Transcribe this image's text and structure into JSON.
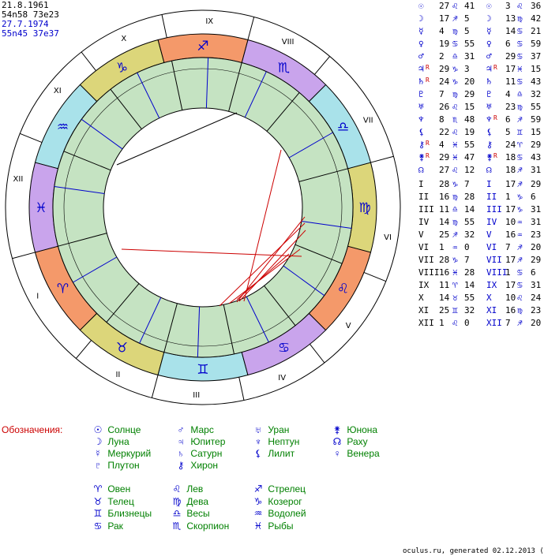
{
  "header": {
    "line1": "21.8.1961",
    "line2": "54n58 73e23",
    "line3": "27.7.1974",
    "line4": "55n45 37e37"
  },
  "colors": {
    "fire": "#f4996a",
    "earth": "#dcd67a",
    "air": "#a9e2ea",
    "water": "#c9a4ec",
    "house_ring": "#c5e3c2",
    "aspect_red": "#cc0000",
    "glyph_blue": "#0000cc",
    "text_green": "#008000"
  },
  "outer_houses": [
    "I",
    "II",
    "III",
    "IV",
    "V",
    "VI",
    "VII",
    "VIII",
    "IX",
    "X",
    "XI",
    "XII"
  ],
  "inner_houses": [
    "I",
    "II",
    "III",
    "IV",
    "V",
    "VI",
    "VII",
    "VIII",
    "IX",
    "X",
    "XI",
    "XII"
  ],
  "signs": [
    "♈",
    "♉",
    "♊",
    "♋",
    "♌",
    "♍",
    "♎",
    "♏",
    "♐",
    "♑",
    "♒",
    "♓"
  ],
  "planet_rows": [
    {
      "g1": "☉",
      "d1": "27",
      "s1": "♌",
      "m1": "41",
      "g2": "☉",
      "d2": "3",
      "s2": "♌",
      "m2": "36"
    },
    {
      "g1": "☽",
      "d1": "17",
      "s1": "♐",
      "m1": "5",
      "g2": "☽",
      "d2": "13",
      "s2": "♍",
      "m2": "42"
    },
    {
      "g1": "☿",
      "d1": "4",
      "s1": "♍",
      "m1": "5",
      "g2": "☿",
      "d2": "14",
      "s2": "♋",
      "m2": "21"
    },
    {
      "g1": "♀",
      "d1": "19",
      "s1": "♋",
      "m1": "55",
      "g2": "♀",
      "d2": "6",
      "s2": "♋",
      "m2": "59"
    },
    {
      "g1": "♂",
      "d1": "2",
      "s1": "♎",
      "m1": "31",
      "g2": "♂",
      "d2": "29",
      "s2": "♋",
      "m2": "37"
    },
    {
      "g1": "♃",
      "r1": "R",
      "d1": "29",
      "s1": "♑",
      "m1": "3",
      "g2": "♃",
      "r2": "R",
      "d2": "17",
      "s2": "♓",
      "m2": "15"
    },
    {
      "g1": "♄",
      "r1": "R",
      "d1": "24",
      "s1": "♑",
      "m1": "20",
      "g2": "♄",
      "d2": "11",
      "s2": "♋",
      "m2": "43"
    },
    {
      "g1": "♇",
      "d1": "7",
      "s1": "♍",
      "m1": "29",
      "g2": "♇",
      "d2": "4",
      "s2": "♎",
      "m2": "32"
    },
    {
      "g1": "♅",
      "d1": "26",
      "s1": "♌",
      "m1": "15",
      "g2": "♅",
      "d2": "23",
      "s2": "♍",
      "m2": "55"
    },
    {
      "g1": "♆",
      "d1": "8",
      "s1": "♏",
      "m1": "48",
      "g2": "♆",
      "r2": "R",
      "d2": "6",
      "s2": "♐",
      "m2": "59"
    },
    {
      "g1": "⚸",
      "d1": "22",
      "s1": "♌",
      "m1": "19",
      "g2": "⚸",
      "d2": "5",
      "s2": "♊",
      "m2": "15"
    },
    {
      "g1": "⚷",
      "r1": "R",
      "d1": "4",
      "s1": "♓",
      "m1": "55",
      "g2": "⚷",
      "d2": "24",
      "s2": "♈",
      "m2": "29"
    },
    {
      "g1": "⚵",
      "r1": "R",
      "d1": "29",
      "s1": "♓",
      "m1": "47",
      "g2": "⚵",
      "r2": "R",
      "d2": "18",
      "s2": "♋",
      "m2": "43"
    },
    {
      "g1": "☊",
      "d1": "27",
      "s1": "♌",
      "m1": "12",
      "g2": "☊",
      "d2": "18",
      "s2": "♐",
      "m2": "31"
    }
  ],
  "house_rows": [
    {
      "h1": "I",
      "d1": "28",
      "s1": "♑",
      "m1": "7",
      "h2": "I",
      "d2": "17",
      "s2": "♐",
      "m2": "29"
    },
    {
      "h1": "II",
      "d1": "16",
      "s1": "♍",
      "m1": "28",
      "h2": "II",
      "d2": "1",
      "s2": "♑",
      "m2": "6"
    },
    {
      "h1": "III",
      "d1": "11",
      "s1": "♎",
      "m1": "14",
      "h2": "III",
      "d2": "17",
      "s2": "♑",
      "m2": "31"
    },
    {
      "h1": "IV",
      "d1": "14",
      "s1": "♍",
      "m1": "55",
      "h2": "IV",
      "d2": "10",
      "s2": "♒",
      "m2": "31"
    },
    {
      "h1": "V",
      "d1": "25",
      "s1": "♐",
      "m1": "32",
      "h2": "V",
      "d2": "16",
      "s2": "♒",
      "m2": "23"
    },
    {
      "h1": "VI",
      "d1": "1",
      "s1": "♒",
      "m1": "0",
      "h2": "VI",
      "d2": "7",
      "s2": "♐",
      "m2": "20"
    },
    {
      "h1": "VII",
      "d1": "28",
      "s1": "♑",
      "m1": "7",
      "h2": "VII",
      "d2": "17",
      "s2": "♐",
      "m2": "29"
    },
    {
      "h1": "VIII",
      "d1": "16",
      "s1": "♓",
      "m1": "28",
      "h2": "VIII",
      "d2": "1",
      "s2": "♋",
      "m2": "6"
    },
    {
      "h1": "IX",
      "d1": "11",
      "s1": "♈",
      "m1": "14",
      "h2": "IX",
      "d2": "17",
      "s2": "♋",
      "m2": "31"
    },
    {
      "h1": "X",
      "d1": "14",
      "s1": "♉",
      "m1": "55",
      "h2": "X",
      "d2": "10",
      "s2": "♌",
      "m2": "24"
    },
    {
      "h1": "XI",
      "d1": "25",
      "s1": "♊",
      "m1": "32",
      "h2": "XI",
      "d2": "16",
      "s2": "♍",
      "m2": "23"
    },
    {
      "h1": "XII",
      "d1": "1",
      "s1": "♌",
      "m1": "0",
      "h2": "XII",
      "d2": "7",
      "s2": "♐",
      "m2": "20"
    }
  ],
  "legend_title": "Обозначения:",
  "legend_planets": [
    {
      "g": "☉",
      "label": "Солнце"
    },
    {
      "g": "♂",
      "label": "Марс"
    },
    {
      "g": "♅",
      "label": "Уран"
    },
    {
      "g": "⚵",
      "label": "Юнона"
    },
    {
      "g": "☽",
      "label": "Луна"
    },
    {
      "g": "♃",
      "label": "Юпитер"
    },
    {
      "g": "♆",
      "label": "Нептун"
    },
    {
      "g": "☊",
      "label": "Раху"
    },
    {
      "g": "☿",
      "label": "Меркурий"
    },
    {
      "g": "♄",
      "label": "Сатурн"
    },
    {
      "g": "⚸",
      "label": "Лилит"
    },
    {
      "g": "♀",
      "label": "Венера"
    },
    {
      "g": "♇",
      "label": "Плутон"
    },
    {
      "g": "⚷",
      "label": "Хирон"
    }
  ],
  "legend_signs": [
    {
      "g": "♈",
      "label": "Овен"
    },
    {
      "g": "♌",
      "label": "Лев"
    },
    {
      "g": "♐",
      "label": "Стрелец"
    },
    {
      "g": "♉",
      "label": "Телец"
    },
    {
      "g": "♍",
      "label": "Дева"
    },
    {
      "g": "♑",
      "label": "Козерог"
    },
    {
      "g": "♊",
      "label": "Близнецы"
    },
    {
      "g": "♎",
      "label": "Весы"
    },
    {
      "g": "♒",
      "label": "Водолей"
    },
    {
      "g": "♋",
      "label": "Рак"
    },
    {
      "g": "♏",
      "label": "Скорпион"
    },
    {
      "g": "♓",
      "label": "Рыбы"
    }
  ],
  "footer": "oculus.ru, generated 02.12.2013 (13149)"
}
